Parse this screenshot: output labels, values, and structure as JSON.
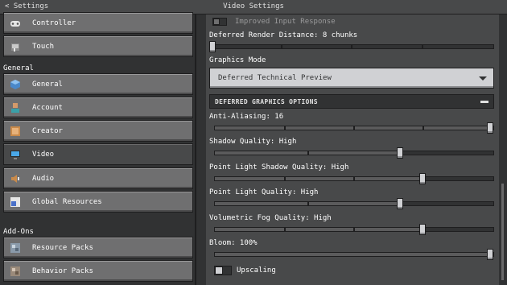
{
  "topbar": {
    "back_label": "< Settings",
    "title": "Video Settings"
  },
  "sidebar": {
    "items_top": [
      {
        "label": "Controller",
        "icon": "controller-icon"
      },
      {
        "label": "Touch",
        "icon": "touch-icon"
      }
    ],
    "general_heading": "General",
    "general_items": [
      {
        "label": "General",
        "icon": "cube-icon"
      },
      {
        "label": "Account",
        "icon": "account-icon"
      },
      {
        "label": "Creator",
        "icon": "creator-icon"
      },
      {
        "label": "Video",
        "icon": "monitor-icon",
        "selected": true
      },
      {
        "label": "Audio",
        "icon": "speaker-icon"
      },
      {
        "label": "Global Resources",
        "icon": "global-resources-icon"
      }
    ],
    "addons_heading": "Add-Ons",
    "addons_items": [
      {
        "label": "Resource Packs",
        "icon": "resource-packs-icon"
      },
      {
        "label": "Behavior Packs",
        "icon": "behavior-packs-icon"
      }
    ]
  },
  "settings": {
    "improved_input": {
      "label": "Improved Input Response",
      "on": false
    },
    "render_distance": {
      "label": "Deferred Render Distance: 8 chunks",
      "level": 0.0
    },
    "graphics_mode": {
      "label": "Graphics Mode",
      "value": "Deferred Technical Preview"
    },
    "deferred_group": {
      "label": "DEFERRED GRAPHICS OPTIONS"
    },
    "anti_aliasing": {
      "label": "Anti-Aliasing: 16",
      "level": 1.0
    },
    "shadow_quality": {
      "label": "Shadow Quality: High",
      "level": 0.67
    },
    "point_light_shadow": {
      "label": "Point Light Shadow Quality: High",
      "level": 0.75
    },
    "point_light_quality": {
      "label": "Point Light Quality: High",
      "level": 0.67
    },
    "volumetric_fog": {
      "label": "Volumetric Fog Quality: High",
      "level": 0.75
    },
    "bloom": {
      "label": "Bloom: 100%",
      "level": 1.0
    },
    "upscaling": {
      "label": "Upscaling",
      "on": false
    }
  },
  "colors": {
    "panel": "#48494a",
    "background": "#313233",
    "button": "#6f6f70",
    "knob": "#d0d1d4"
  }
}
